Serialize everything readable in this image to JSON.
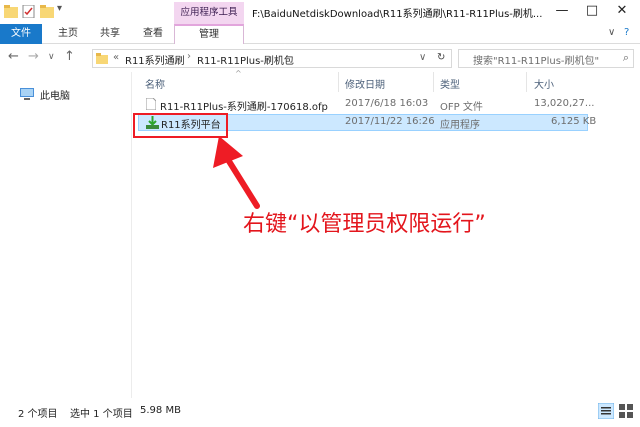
{
  "window": {
    "tool_header": "应用程序工具",
    "title": "F:\\BaiduNetdiskDownload\\R11系列通刷\\R11-R11Plus-刷机...",
    "minimize": "—",
    "maximize": "□",
    "close": "✕"
  },
  "ribbon": {
    "tabs": [
      "文件",
      "主页",
      "共享",
      "查看"
    ],
    "manage": "管理",
    "collapse": "∨",
    "help": "?"
  },
  "nav": {
    "back": "←",
    "forward": "→",
    "dropdown": "∨",
    "up": "↑",
    "prefix": "«",
    "breadcrumb": [
      "R11系列通刷",
      "R11-R11Plus-刷机包"
    ],
    "refresh": "↻",
    "search_placeholder": "搜索\"R11-R11Plus-刷机包\"",
    "search_icon": "⌕"
  },
  "sidebar": {
    "items": [
      {
        "label": "此电脑",
        "icon": "pc-icon"
      }
    ]
  },
  "columns": {
    "name": "名称",
    "modified": "修改日期",
    "type": "类型",
    "size": "大小"
  },
  "files": [
    {
      "name": "R11-R11Plus-系列通刷-170618.ofp",
      "modified": "2017/6/18 16:03",
      "type": "OFP 文件",
      "size": "13,020,27...",
      "icon": "file-icon",
      "selected": false
    },
    {
      "name": "R11系列平台",
      "modified": "2017/11/22 16:26",
      "type": "应用程序",
      "size": "6,125 KB",
      "icon": "app-install-icon",
      "selected": true
    }
  ],
  "annotation": {
    "text": "右键“以管理员权限运行”",
    "color": "#e3151c"
  },
  "status": {
    "count": "2 个项目",
    "selected": "选中 1 个项目",
    "size": "5.98 MB"
  },
  "colors": {
    "file_tab": "#1979ca",
    "manage_header": "#f3d6f0",
    "selection": "#cce8ff"
  }
}
